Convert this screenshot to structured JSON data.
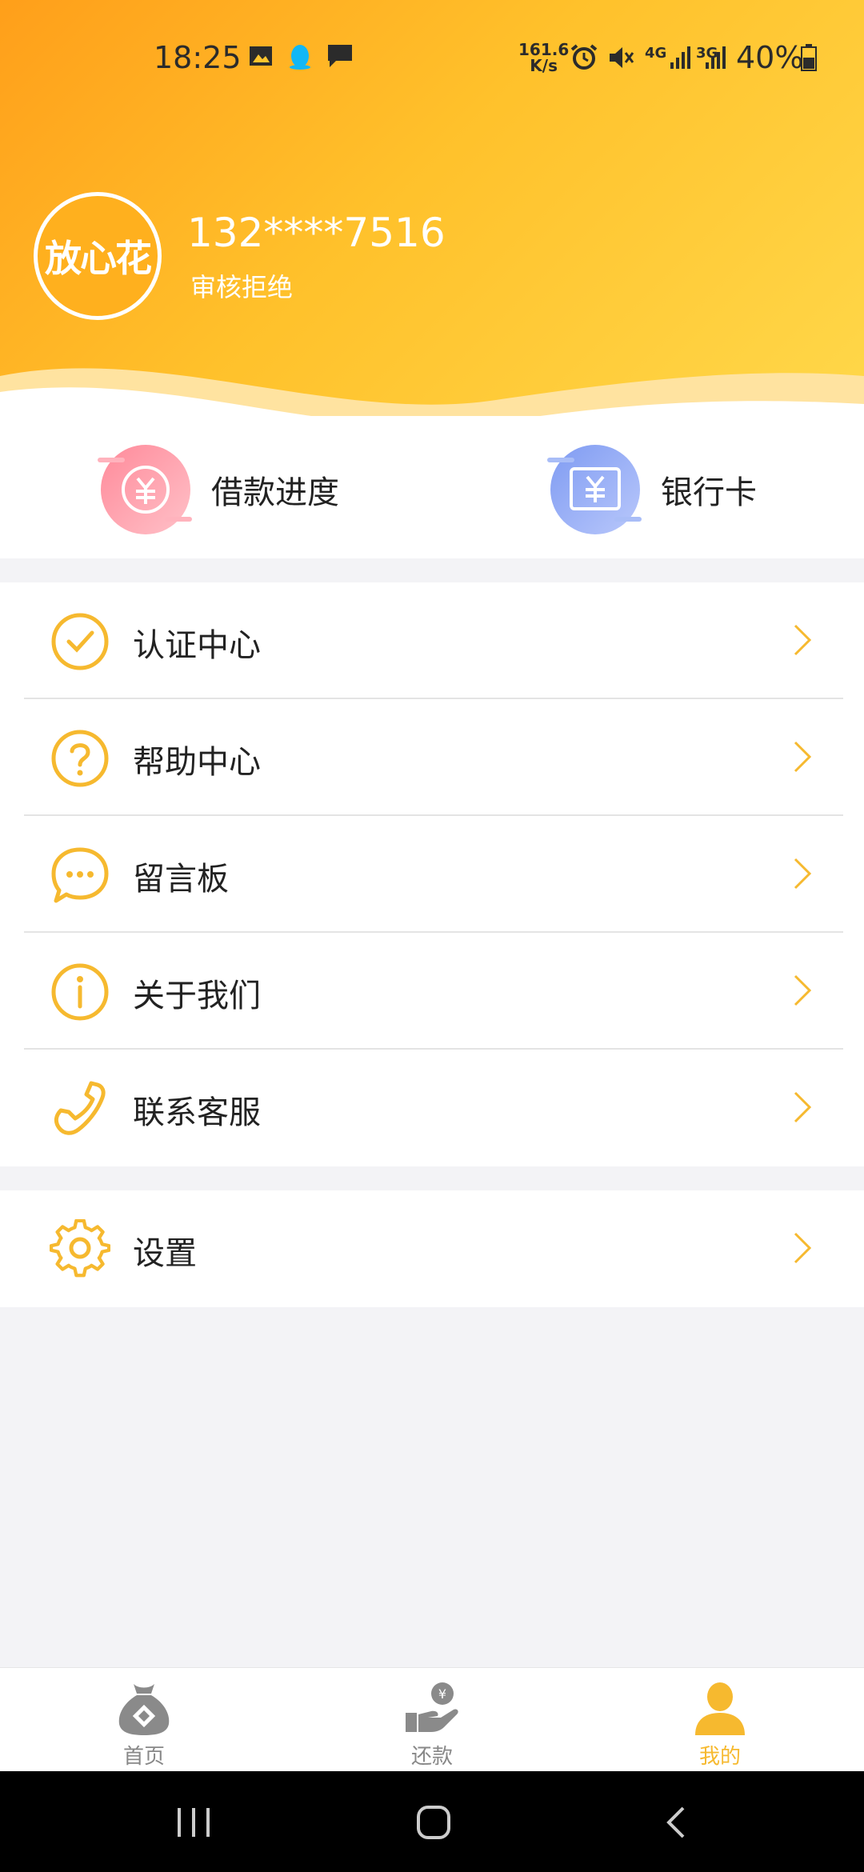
{
  "status_bar": {
    "time": "18:25",
    "speed_value": "161.6",
    "speed_unit": "K/s",
    "net_4g": "4G",
    "net_3g": "3G",
    "battery": "40%"
  },
  "profile": {
    "logo_text": "放心花",
    "phone": "132****7516",
    "status": "审核拒绝"
  },
  "quick_actions": [
    {
      "label": "借款进度"
    },
    {
      "label": "银行卡"
    }
  ],
  "menu_group1": [
    {
      "label": "认证中心"
    },
    {
      "label": "帮助中心"
    },
    {
      "label": "留言板"
    },
    {
      "label": "关于我们"
    },
    {
      "label": "联系客服"
    }
  ],
  "menu_group2": [
    {
      "label": "设置"
    }
  ],
  "tabs": [
    {
      "label": "首页"
    },
    {
      "label": "还款"
    },
    {
      "label": "我的"
    }
  ],
  "colors": {
    "accent": "#f6b92f",
    "header_start": "#ff9f1a",
    "header_end": "#ffd84a"
  }
}
